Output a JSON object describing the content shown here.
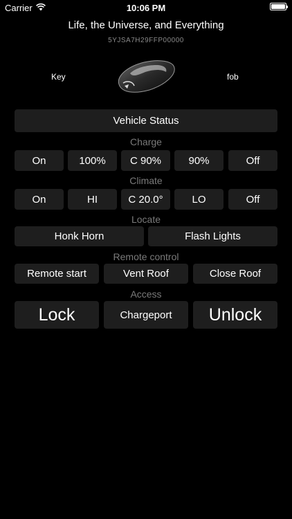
{
  "status_bar": {
    "carrier": "Carrier",
    "time": "10:06 PM"
  },
  "header": {
    "title": "Life, the Universe, and Everything",
    "vin": "5YJSA7H29FFP00000"
  },
  "fob": {
    "left_label": "Key",
    "right_label": "fob"
  },
  "vehicle_status": {
    "label": "Vehicle Status"
  },
  "charge": {
    "label": "Charge",
    "buttons": [
      "On",
      "100%",
      "C 90%",
      "90%",
      "Off"
    ]
  },
  "climate": {
    "label": "Climate",
    "buttons": [
      "On",
      "HI",
      "C 20.0°",
      "LO",
      "Off"
    ]
  },
  "locate": {
    "label": "Locate",
    "buttons": [
      "Honk Horn",
      "Flash Lights"
    ]
  },
  "remote": {
    "label": "Remote control",
    "buttons": [
      "Remote start",
      "Vent Roof",
      "Close Roof"
    ]
  },
  "access": {
    "label": "Access",
    "buttons": [
      "Lock",
      "Chargeport",
      "Unlock"
    ]
  },
  "colors": {
    "background": "#000000",
    "button": "#1e1e1e",
    "section_label": "#7a7a7a"
  }
}
